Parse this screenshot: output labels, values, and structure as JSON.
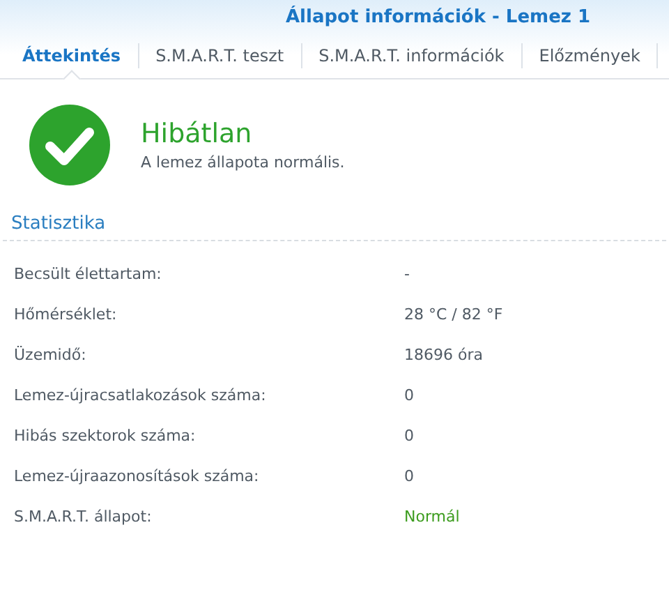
{
  "window": {
    "title": "Állapot információk - Lemez 1"
  },
  "tabs": [
    {
      "label": "Áttekintés",
      "selected": true
    },
    {
      "label": "S.M.A.R.T. teszt",
      "selected": false
    },
    {
      "label": "S.M.A.R.T. információk",
      "selected": false
    },
    {
      "label": "Előzmények",
      "selected": false
    }
  ],
  "health": {
    "kind": "ok",
    "title": "Hibátlan",
    "description": "A lemez állapota normális."
  },
  "statistics": {
    "heading": "Statisztika",
    "rows": [
      {
        "label": "Becsült élettartam:",
        "value": "-",
        "kind": "text"
      },
      {
        "label": "Hőmérséklet:",
        "value": "28 °C / 82 °F",
        "kind": "text"
      },
      {
        "label": "Üzemidő:",
        "value": "18696 óra",
        "kind": "text"
      },
      {
        "label": "Lemez-újracsatlakozások száma:",
        "value": "0",
        "kind": "text"
      },
      {
        "label": "Hibás szektorok száma:",
        "value": "0",
        "kind": "text"
      },
      {
        "label": "Lemez-újraazonosítások száma:",
        "value": "0",
        "kind": "text"
      },
      {
        "label": "S.M.A.R.T. állapot:",
        "value": "Normál",
        "kind": "status"
      }
    ]
  }
}
